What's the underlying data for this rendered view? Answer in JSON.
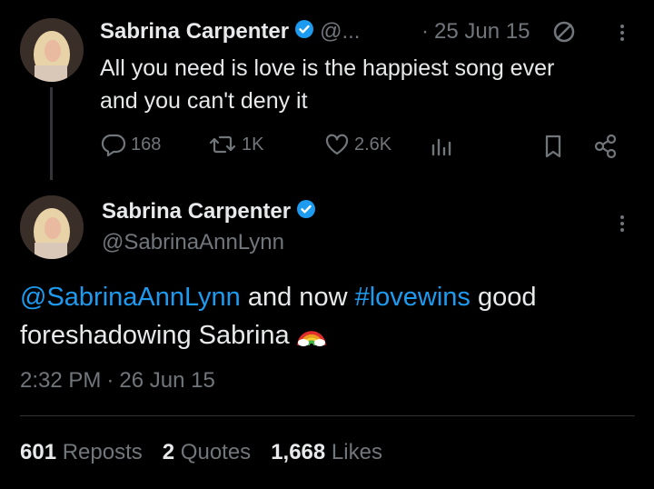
{
  "tweet1": {
    "author_name": "Sabrina Carpenter",
    "handle_truncated": "@...",
    "separator": "·",
    "date": "25 Jun 15",
    "text_line1": "All you need is love is the happiest song ever",
    "text_line2": "and you can't deny it",
    "replies": "168",
    "reposts": "1K",
    "likes": "2.6K"
  },
  "tweet2": {
    "author_name": "Sabrina Carpenter",
    "handle": "@SabrinaAnnLynn",
    "mention": "@SabrinaAnnLynn",
    "text_mid": " and now ",
    "hashtag": "#lovewins",
    "text_end": " good",
    "text_line2": "foreshadowing Sabrina ",
    "emoji": "🌈",
    "time": "2:32 PM",
    "separator": "·",
    "date": "26 Jun 15",
    "reposts_count": "601",
    "reposts_label": "Reposts",
    "quotes_count": "2",
    "quotes_label": "Quotes",
    "likes_count": "1,668",
    "likes_label": "Likes"
  },
  "colors": {
    "accent": "#1d9bf0",
    "muted": "#71767b",
    "text": "#e7e9ea",
    "background": "#000000"
  }
}
